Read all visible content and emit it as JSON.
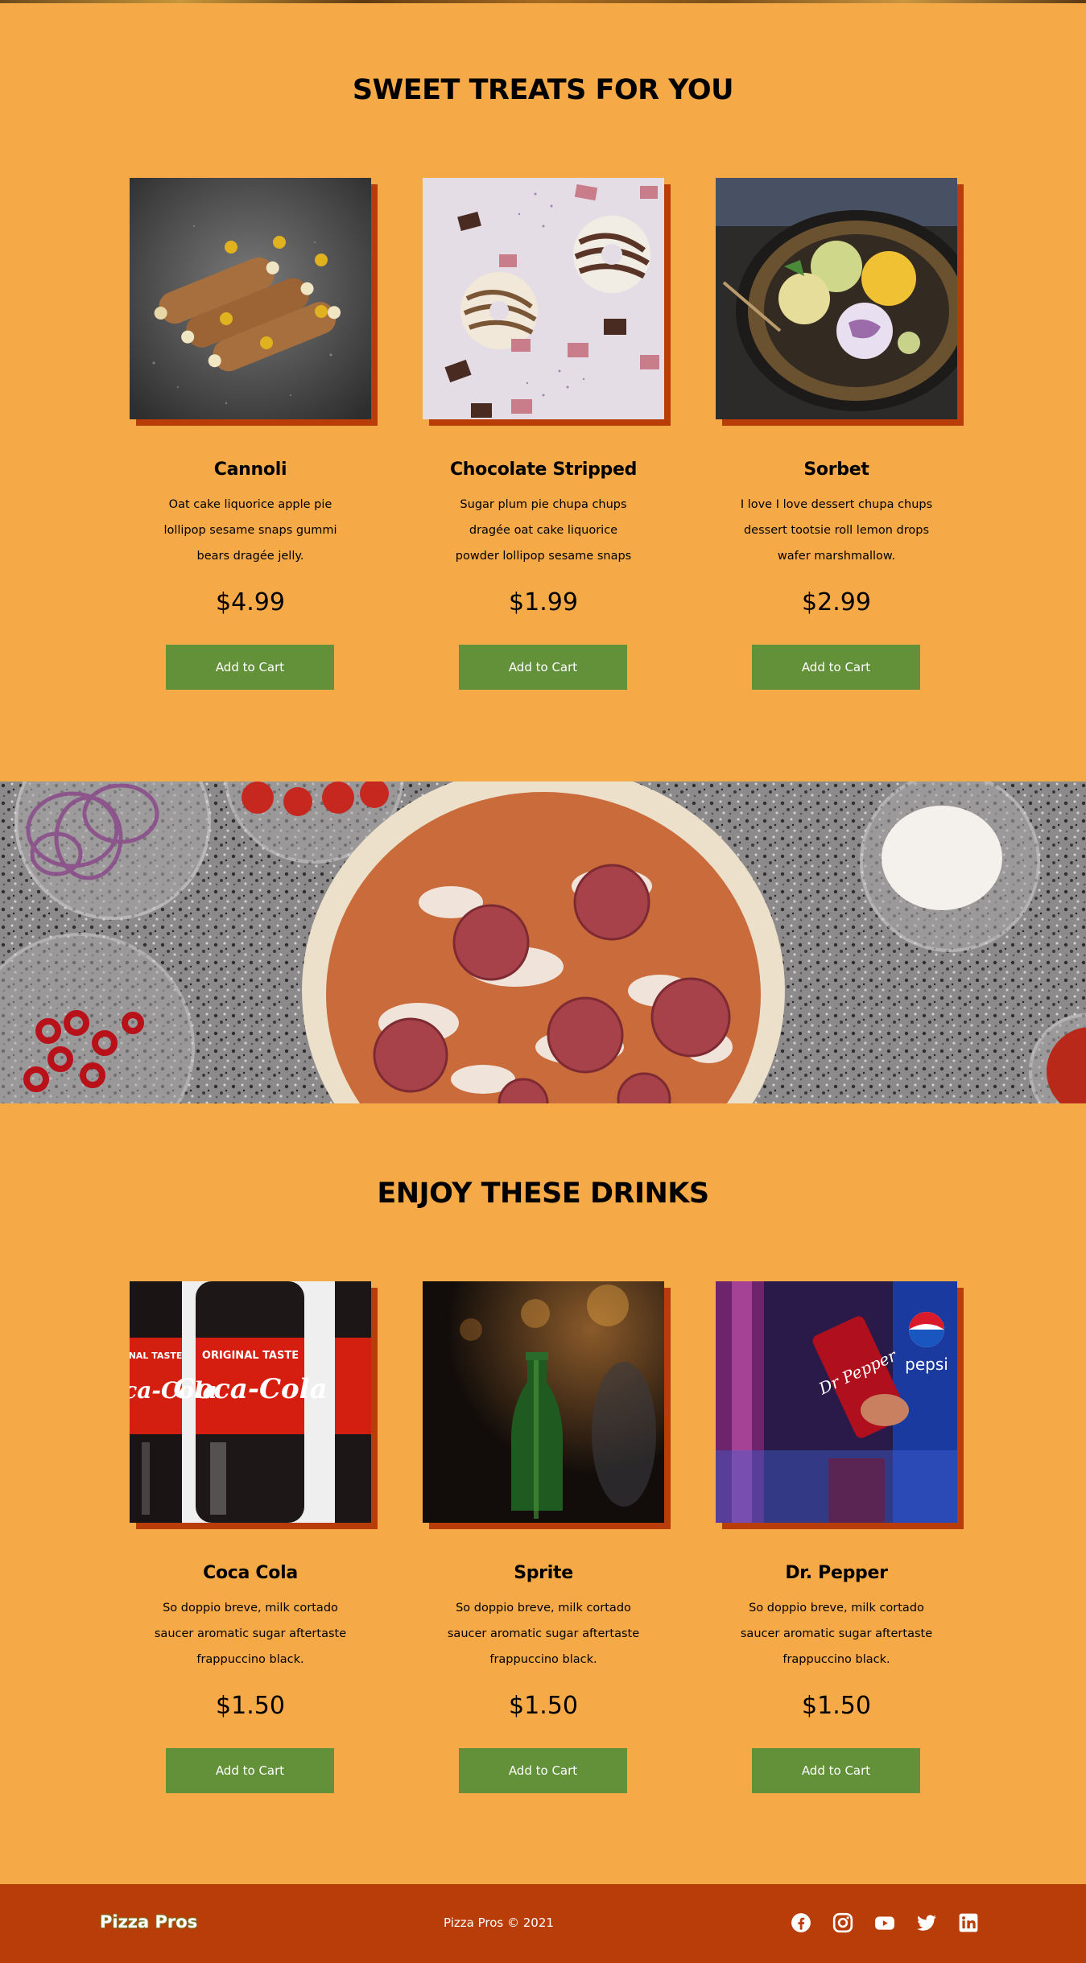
{
  "desserts": {
    "title": "SWEET TREATS FOR YOU",
    "items": [
      {
        "name": "Cannoli",
        "description": "Oat cake liquorice apple pie lollipop sesame snaps gummi bears dragée jelly.",
        "price": "$4.99",
        "button": "Add to Cart"
      },
      {
        "name": "Chocolate Stripped",
        "description": "Sugar plum pie chupa chups dragée oat cake liquorice powder lollipop sesame snaps",
        "price": "$1.99",
        "button": "Add to Cart"
      },
      {
        "name": "Sorbet",
        "description": "I love I love dessert chupa chups dessert tootsie roll lemon drops wafer marshmallow.",
        "price": "$2.99",
        "button": "Add to Cart"
      }
    ]
  },
  "drinks": {
    "title": "ENJOY THESE DRINKS",
    "items": [
      {
        "name": "Coca Cola",
        "description": "So doppio breve, milk cortado saucer aromatic sugar aftertaste frappuccino black.",
        "price": "$1.50",
        "button": "Add to Cart",
        "bottle_label": "ORIGINAL TASTE",
        "brand_text": "Coca-Cola",
        "edge_label": "INAL TASTE"
      },
      {
        "name": "Sprite",
        "description": "So doppio breve, milk cortado saucer aromatic sugar aftertaste frappuccino black.",
        "price": "$1.50",
        "button": "Add to Cart"
      },
      {
        "name": "Dr. Pepper",
        "description": "So doppio breve, milk cortado saucer aromatic sugar aftertaste frappuccino black.",
        "price": "$1.50",
        "button": "Add to Cart",
        "can_text": "Dr Pepper",
        "pepsi_text": "pepsi"
      }
    ]
  },
  "footer": {
    "brand": "Pizza Pros",
    "copyright": "Pizza Pros © 2021",
    "socials": [
      "facebook-icon",
      "instagram-icon",
      "youtube-icon",
      "twitter-icon",
      "linkedin-icon"
    ]
  },
  "colors": {
    "background": "#f5a947",
    "accent": "#b83d08",
    "button": "#62913a",
    "footer": "#b83d08"
  }
}
